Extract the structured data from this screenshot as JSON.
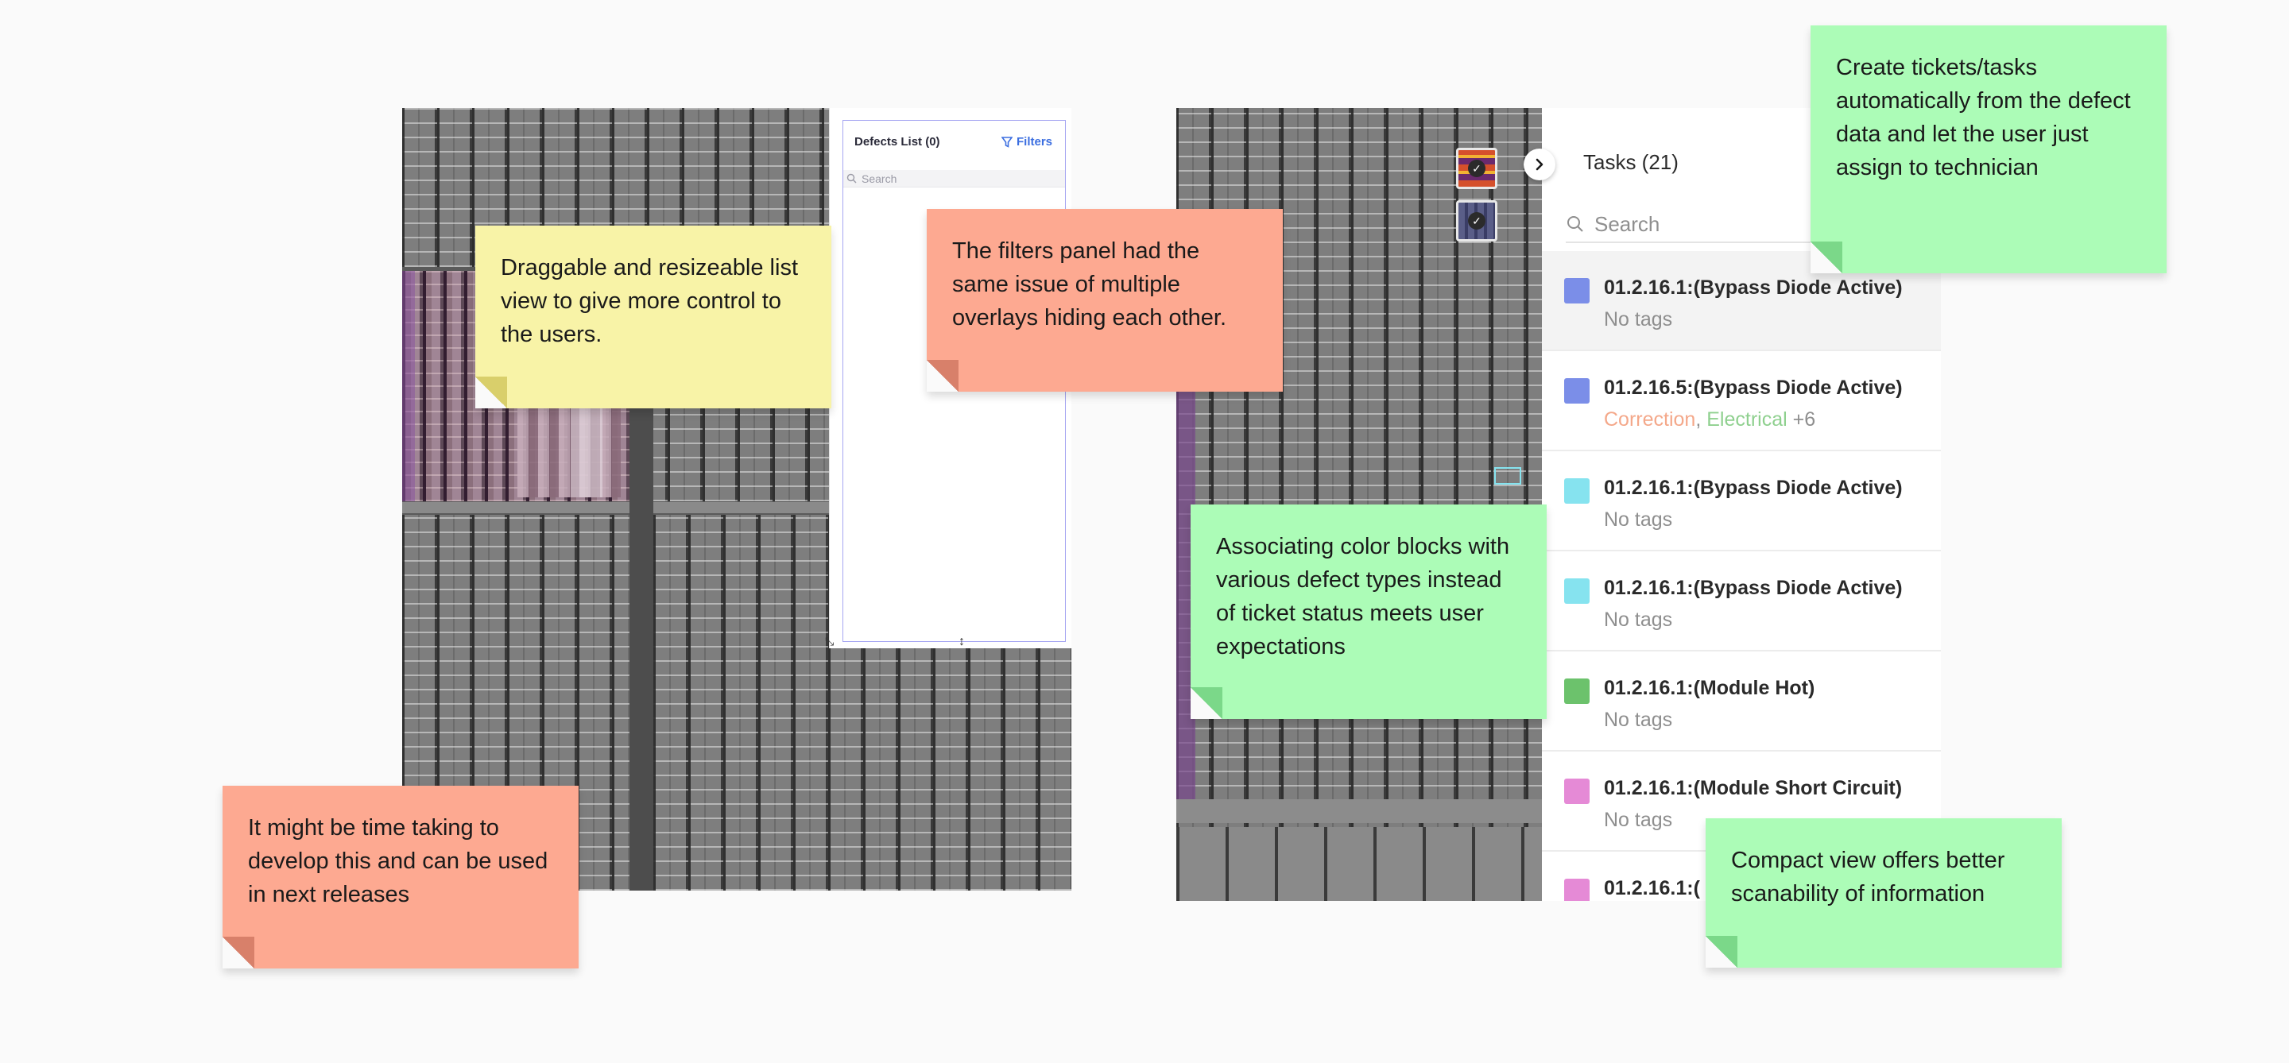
{
  "defects_list": {
    "title": "Defects List (0)",
    "filters_label": "Filters",
    "search_placeholder": "Search"
  },
  "tasks": {
    "title": "Tasks (21)",
    "search_placeholder": "Search",
    "items": [
      {
        "name": "01.2.16.1:(Bypass Diode Active)",
        "color": "#7b8ee8",
        "tags": "No tags"
      },
      {
        "name": "01.2.16.5:(Bypass Diode Active)",
        "color": "#7b8ee8",
        "tag1": "Correction",
        "tag1_color": "#f4a88a",
        "sep": ",",
        "tag2": "Electrical",
        "tag2_color": "#8fd08f",
        "more": "+6"
      },
      {
        "name": "01.2.16.1:(Bypass Diode Active)",
        "color": "#86e3ef",
        "tags": "No tags"
      },
      {
        "name": "01.2.16.1:(Bypass Diode Active)",
        "color": "#86e3ef",
        "tags": "No tags"
      },
      {
        "name": "01.2.16.1:(Module Hot)",
        "color": "#6cc26c",
        "tags": "No tags"
      },
      {
        "name": "01.2.16.1:(Module Short Circuit)",
        "color": "#e58ad6",
        "tags": "No tags"
      },
      {
        "name": "01.2.16.1:(",
        "color": "#e58ad6"
      }
    ]
  },
  "notes": {
    "draggable": "Draggable and resizeable list view to give more control to the users.",
    "filters": "The filters panel had the same issue of multiple overlays hiding each other.",
    "time_taking": "It might be time taking to develop this and can be used in next releases",
    "color_blocks": "Associating color blocks with various defect types instead of ticket status meets user expectations",
    "create_tickets": "Create tickets/tasks automatically from the defect data and let the user just assign to technician",
    "compact": "Compact view offers better scanability of information"
  }
}
